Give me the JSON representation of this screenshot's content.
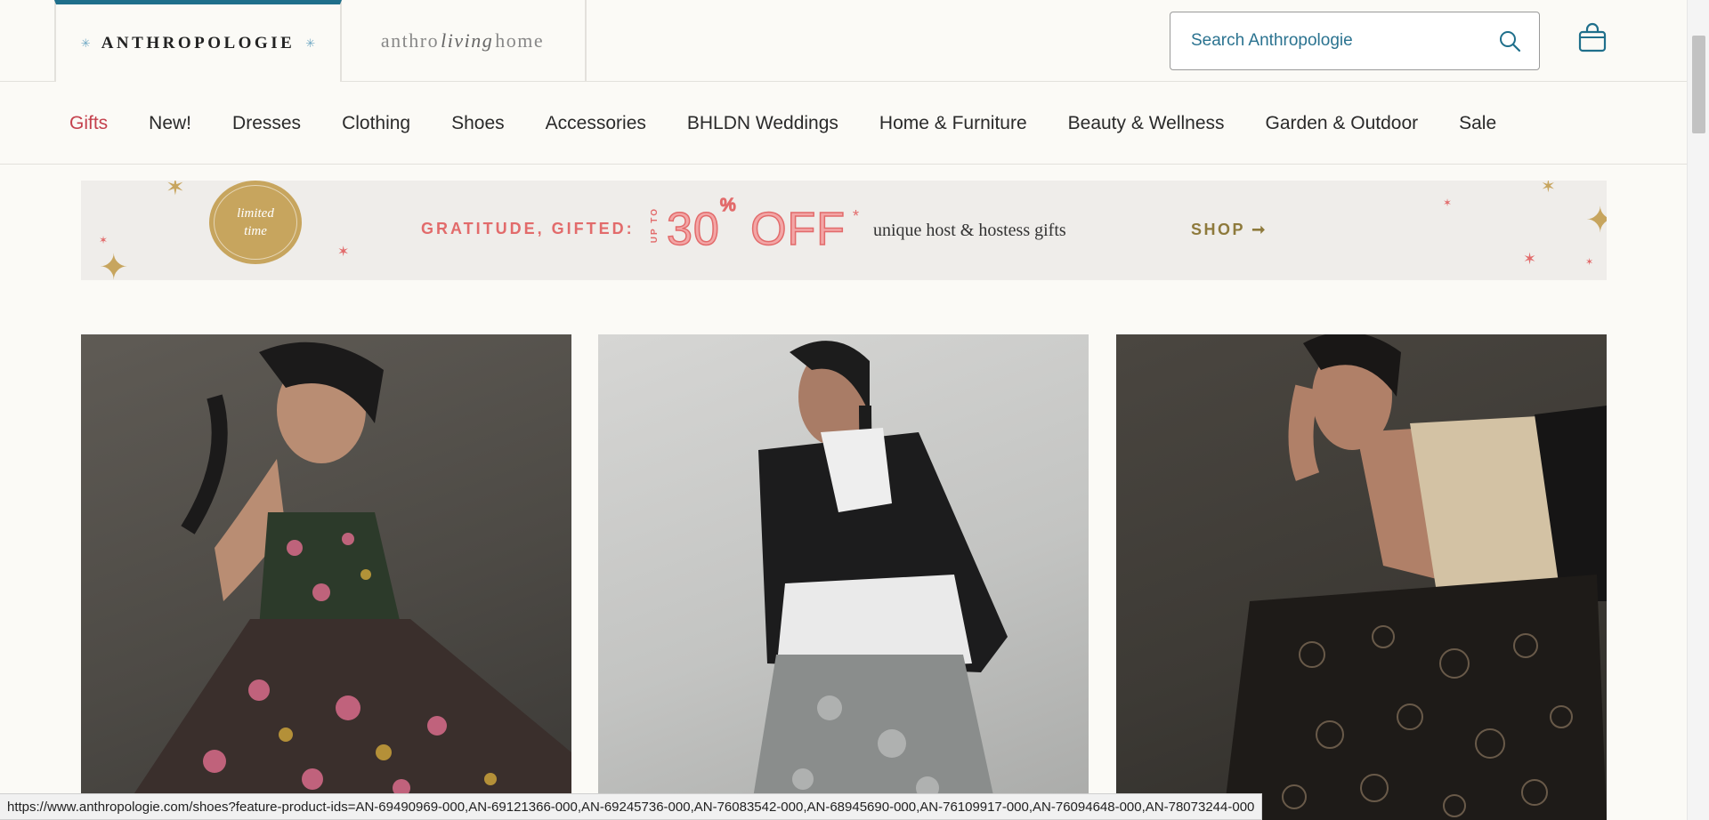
{
  "header": {
    "brand_primary": "ANTHROPOLOGIE",
    "brand_secondary_part1": "anthro",
    "brand_secondary_script": "living",
    "brand_secondary_part2": "home",
    "search_placeholder": "Search Anthropologie",
    "accent_color": "#1f6f8b"
  },
  "nav": {
    "items": [
      {
        "label": "Gifts",
        "highlight": true
      },
      {
        "label": "New!"
      },
      {
        "label": "Dresses"
      },
      {
        "label": "Clothing"
      },
      {
        "label": "Shoes"
      },
      {
        "label": "Accessories"
      },
      {
        "label": "BHLDN Weddings"
      },
      {
        "label": "Home & Furniture"
      },
      {
        "label": "Beauty & Wellness"
      },
      {
        "label": "Garden & Outdoor"
      },
      {
        "label": "Sale"
      }
    ],
    "highlight_color": "#c4414d"
  },
  "banner": {
    "badge_line1": "limited",
    "badge_line2": "time",
    "headline": "GRATITUDE, GIFTED:",
    "upto": "UP TO",
    "discount": "30",
    "discount_percent": "%",
    "discount_off": " OFF",
    "asterisk": "*",
    "subline": "unique host & hostess gifts",
    "cta": "SHOP ➞",
    "accent_color": "#e26b6b",
    "gold_color": "#c7a55e"
  },
  "products": [
    {
      "name": "floral pleated dress photo"
    },
    {
      "name": "leather jacket with ruffle blouse photo"
    },
    {
      "name": "lace pants with satin cami photo"
    }
  ],
  "status_bar": {
    "url": "https://www.anthropologie.com/shoes?feature-product-ids=AN-69490969-000,AN-69121366-000,AN-69245736-000,AN-76083542-000,AN-68945690-000,AN-76109917-000,AN-76094648-000,AN-78073244-000"
  }
}
